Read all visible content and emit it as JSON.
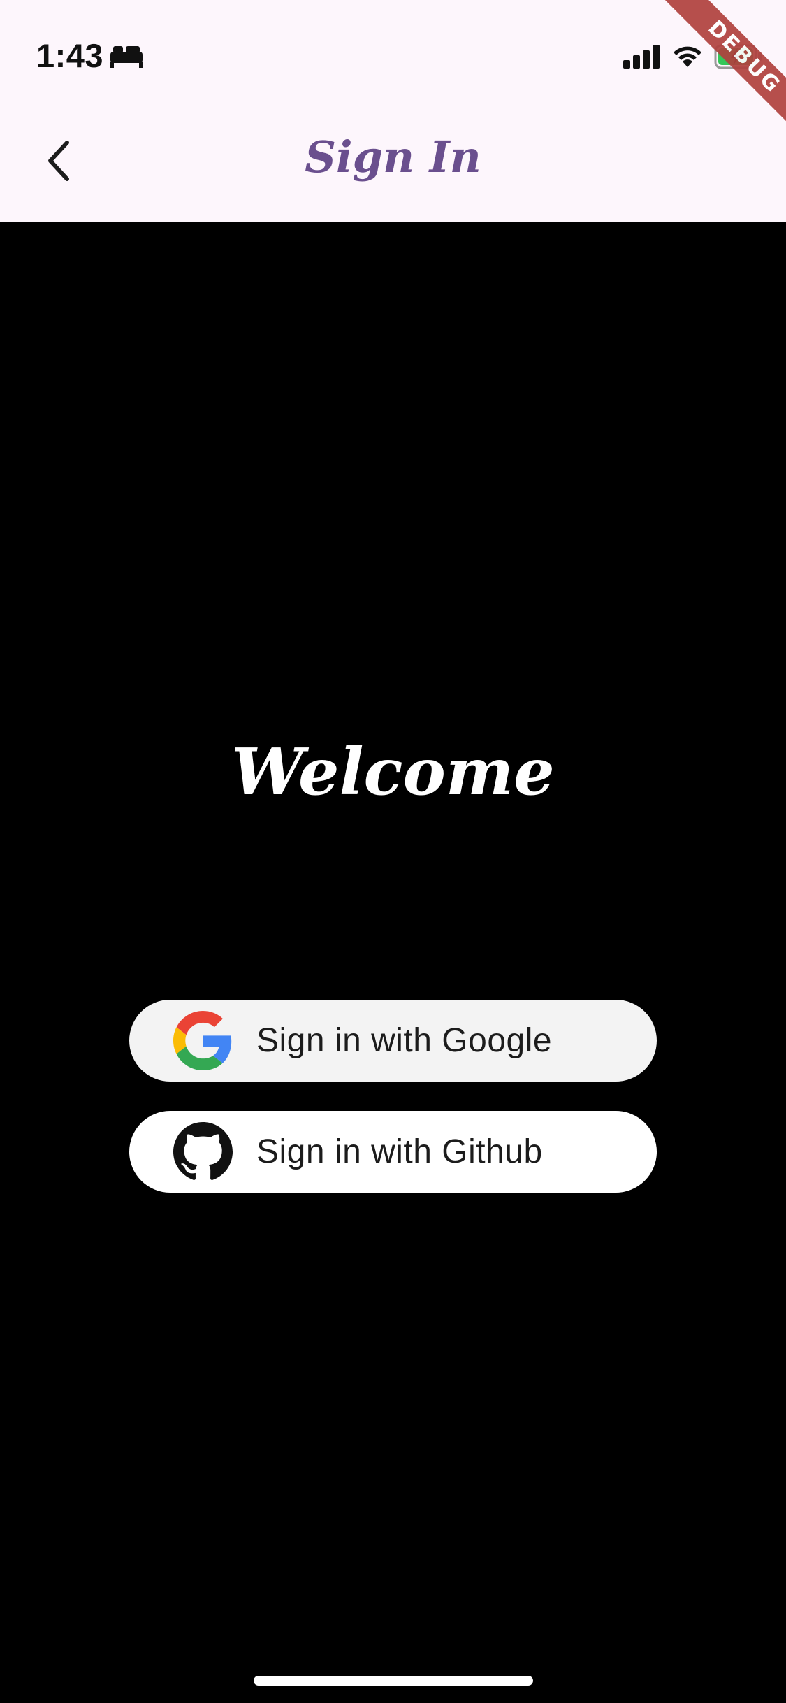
{
  "status_bar": {
    "time": "1:43",
    "icons": [
      "bed-icon",
      "cellular-signal-icon",
      "wifi-icon",
      "battery-charging-icon"
    ]
  },
  "app_bar": {
    "title": "Sign In",
    "title_color": "#6a4f8e",
    "background": "#fdf6fc",
    "back_icon": "chevron-left-icon"
  },
  "debug_banner": {
    "label": "DEBUG"
  },
  "main": {
    "background": "#000000",
    "welcome": "Welcome",
    "buttons": [
      {
        "label": "Sign in with Google",
        "icon": "google-logo-icon",
        "background": "#f3f3f3"
      },
      {
        "label": "Sign in with Github",
        "icon": "github-logo-icon",
        "background": "#ffffff"
      }
    ]
  }
}
